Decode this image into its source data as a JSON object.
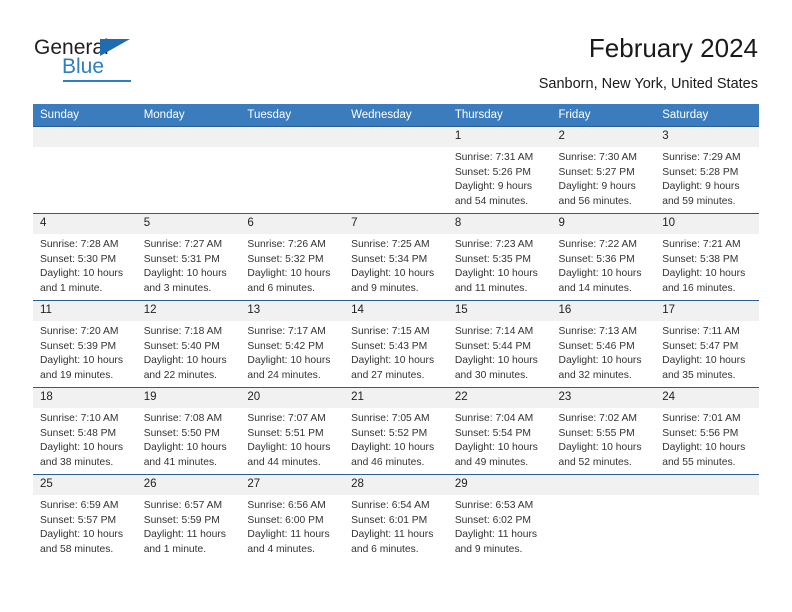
{
  "brand": {
    "name_part1": "General",
    "name_part2": "Blue"
  },
  "header": {
    "title": "February 2024",
    "location": "Sanborn, New York, United States"
  },
  "colors": {
    "header_blue": "#3b7cbe",
    "row_rule": "#2a5f96",
    "daynum_band": "#f1f1f1",
    "brand_blue": "#2d7fc1"
  },
  "labels": {
    "sunrise": "Sunrise:",
    "sunset": "Sunset:",
    "daylight": "Daylight:"
  },
  "weekdays": [
    "Sunday",
    "Monday",
    "Tuesday",
    "Wednesday",
    "Thursday",
    "Friday",
    "Saturday"
  ],
  "weeks": [
    [
      {
        "day": ""
      },
      {
        "day": ""
      },
      {
        "day": ""
      },
      {
        "day": ""
      },
      {
        "day": "1",
        "sunrise": "Sunrise: 7:31 AM",
        "sunset": "Sunset: 5:26 PM",
        "daylight": "Daylight: 9 hours and 54 minutes."
      },
      {
        "day": "2",
        "sunrise": "Sunrise: 7:30 AM",
        "sunset": "Sunset: 5:27 PM",
        "daylight": "Daylight: 9 hours and 56 minutes."
      },
      {
        "day": "3",
        "sunrise": "Sunrise: 7:29 AM",
        "sunset": "Sunset: 5:28 PM",
        "daylight": "Daylight: 9 hours and 59 minutes."
      }
    ],
    [
      {
        "day": "4",
        "sunrise": "Sunrise: 7:28 AM",
        "sunset": "Sunset: 5:30 PM",
        "daylight": "Daylight: 10 hours and 1 minute."
      },
      {
        "day": "5",
        "sunrise": "Sunrise: 7:27 AM",
        "sunset": "Sunset: 5:31 PM",
        "daylight": "Daylight: 10 hours and 3 minutes."
      },
      {
        "day": "6",
        "sunrise": "Sunrise: 7:26 AM",
        "sunset": "Sunset: 5:32 PM",
        "daylight": "Daylight: 10 hours and 6 minutes."
      },
      {
        "day": "7",
        "sunrise": "Sunrise: 7:25 AM",
        "sunset": "Sunset: 5:34 PM",
        "daylight": "Daylight: 10 hours and 9 minutes."
      },
      {
        "day": "8",
        "sunrise": "Sunrise: 7:23 AM",
        "sunset": "Sunset: 5:35 PM",
        "daylight": "Daylight: 10 hours and 11 minutes."
      },
      {
        "day": "9",
        "sunrise": "Sunrise: 7:22 AM",
        "sunset": "Sunset: 5:36 PM",
        "daylight": "Daylight: 10 hours and 14 minutes."
      },
      {
        "day": "10",
        "sunrise": "Sunrise: 7:21 AM",
        "sunset": "Sunset: 5:38 PM",
        "daylight": "Daylight: 10 hours and 16 minutes."
      }
    ],
    [
      {
        "day": "11",
        "sunrise": "Sunrise: 7:20 AM",
        "sunset": "Sunset: 5:39 PM",
        "daylight": "Daylight: 10 hours and 19 minutes."
      },
      {
        "day": "12",
        "sunrise": "Sunrise: 7:18 AM",
        "sunset": "Sunset: 5:40 PM",
        "daylight": "Daylight: 10 hours and 22 minutes."
      },
      {
        "day": "13",
        "sunrise": "Sunrise: 7:17 AM",
        "sunset": "Sunset: 5:42 PM",
        "daylight": "Daylight: 10 hours and 24 minutes."
      },
      {
        "day": "14",
        "sunrise": "Sunrise: 7:15 AM",
        "sunset": "Sunset: 5:43 PM",
        "daylight": "Daylight: 10 hours and 27 minutes."
      },
      {
        "day": "15",
        "sunrise": "Sunrise: 7:14 AM",
        "sunset": "Sunset: 5:44 PM",
        "daylight": "Daylight: 10 hours and 30 minutes."
      },
      {
        "day": "16",
        "sunrise": "Sunrise: 7:13 AM",
        "sunset": "Sunset: 5:46 PM",
        "daylight": "Daylight: 10 hours and 32 minutes."
      },
      {
        "day": "17",
        "sunrise": "Sunrise: 7:11 AM",
        "sunset": "Sunset: 5:47 PM",
        "daylight": "Daylight: 10 hours and 35 minutes."
      }
    ],
    [
      {
        "day": "18",
        "sunrise": "Sunrise: 7:10 AM",
        "sunset": "Sunset: 5:48 PM",
        "daylight": "Daylight: 10 hours and 38 minutes."
      },
      {
        "day": "19",
        "sunrise": "Sunrise: 7:08 AM",
        "sunset": "Sunset: 5:50 PM",
        "daylight": "Daylight: 10 hours and 41 minutes."
      },
      {
        "day": "20",
        "sunrise": "Sunrise: 7:07 AM",
        "sunset": "Sunset: 5:51 PM",
        "daylight": "Daylight: 10 hours and 44 minutes."
      },
      {
        "day": "21",
        "sunrise": "Sunrise: 7:05 AM",
        "sunset": "Sunset: 5:52 PM",
        "daylight": "Daylight: 10 hours and 46 minutes."
      },
      {
        "day": "22",
        "sunrise": "Sunrise: 7:04 AM",
        "sunset": "Sunset: 5:54 PM",
        "daylight": "Daylight: 10 hours and 49 minutes."
      },
      {
        "day": "23",
        "sunrise": "Sunrise: 7:02 AM",
        "sunset": "Sunset: 5:55 PM",
        "daylight": "Daylight: 10 hours and 52 minutes."
      },
      {
        "day": "24",
        "sunrise": "Sunrise: 7:01 AM",
        "sunset": "Sunset: 5:56 PM",
        "daylight": "Daylight: 10 hours and 55 minutes."
      }
    ],
    [
      {
        "day": "25",
        "sunrise": "Sunrise: 6:59 AM",
        "sunset": "Sunset: 5:57 PM",
        "daylight": "Daylight: 10 hours and 58 minutes."
      },
      {
        "day": "26",
        "sunrise": "Sunrise: 6:57 AM",
        "sunset": "Sunset: 5:59 PM",
        "daylight": "Daylight: 11 hours and 1 minute."
      },
      {
        "day": "27",
        "sunrise": "Sunrise: 6:56 AM",
        "sunset": "Sunset: 6:00 PM",
        "daylight": "Daylight: 11 hours and 4 minutes."
      },
      {
        "day": "28",
        "sunrise": "Sunrise: 6:54 AM",
        "sunset": "Sunset: 6:01 PM",
        "daylight": "Daylight: 11 hours and 6 minutes."
      },
      {
        "day": "29",
        "sunrise": "Sunrise: 6:53 AM",
        "sunset": "Sunset: 6:02 PM",
        "daylight": "Daylight: 11 hours and 9 minutes."
      },
      {
        "day": ""
      },
      {
        "day": ""
      }
    ]
  ]
}
